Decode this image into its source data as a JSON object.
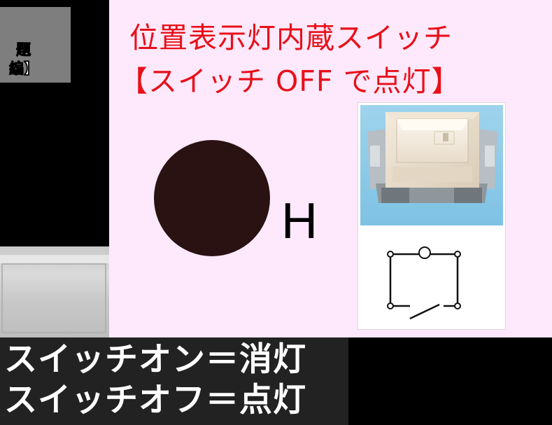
{
  "left_label": {
    "line1": "題",
    "line2_red": "）",
    "line2_white": "編】"
  },
  "slide": {
    "title_line1": "位置表示灯内蔵スイッチ",
    "title_line2": "【スイッチ OFF で点灯】",
    "symbol_letter": "H"
  },
  "captions": {
    "line1": "スイッチオン＝消灯",
    "line2": "スイッチオフ＝点灯"
  },
  "colors": {
    "slide_background": "#fde9fb",
    "title_red": "#e8101a",
    "symbol_dot": "#2a1213"
  }
}
